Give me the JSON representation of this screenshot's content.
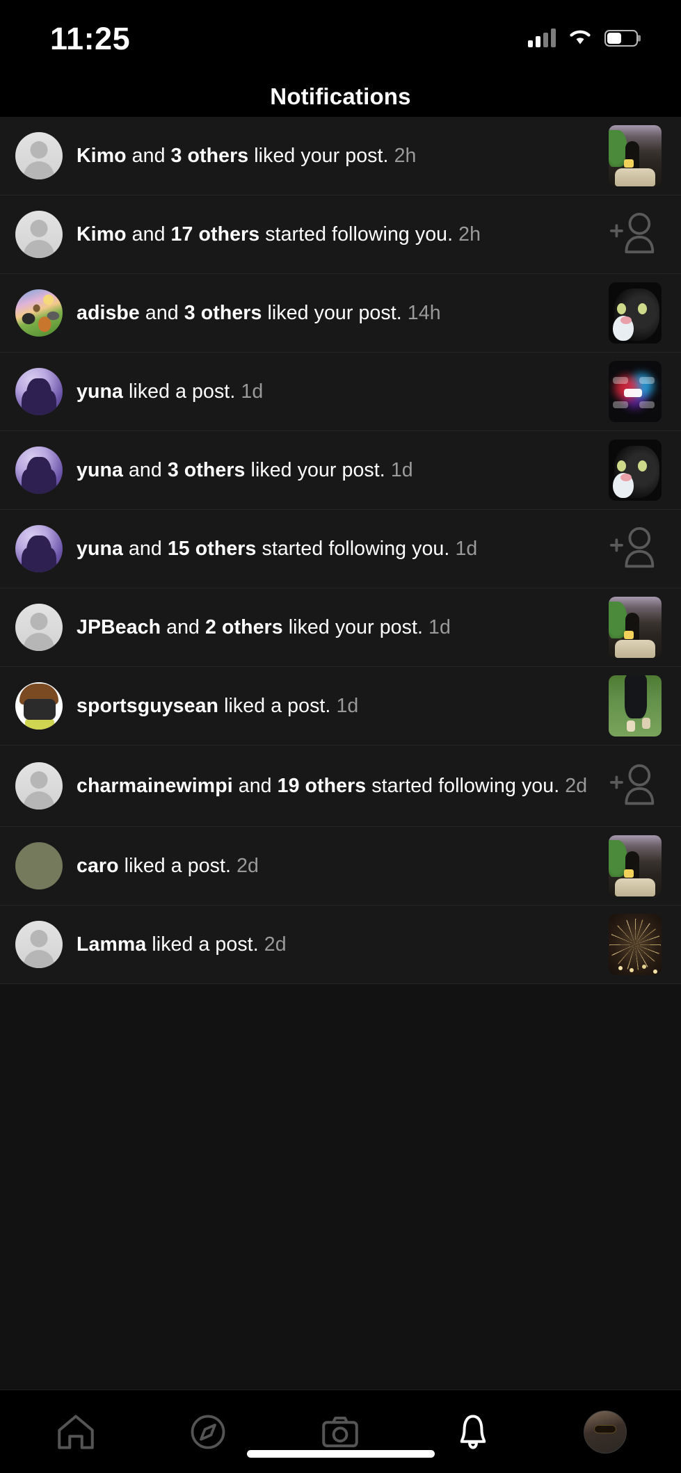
{
  "status_bar": {
    "time": "11:25",
    "signal_bars_filled": 2,
    "signal_bars_total": 4,
    "wifi": "wifi-icon",
    "battery_percent": 50
  },
  "header": {
    "title": "Notifications"
  },
  "notifications": [
    {
      "user": "Kimo",
      "others": "and 3 others",
      "action": "liked your post.",
      "time": "2h",
      "avatar": "default-avatar",
      "right": "post-thumbnail",
      "thumb_kind": "plant-cat-photo"
    },
    {
      "user": "Kimo",
      "others": "and 17 others",
      "action": "started following you.",
      "time": "2h",
      "avatar": "default-avatar",
      "right": "follow-icon",
      "thumb_kind": ""
    },
    {
      "user": "adisbe",
      "others": "and 3 others",
      "action": "liked your post.",
      "time": "14h",
      "avatar": "jungle-avatar",
      "right": "post-thumbnail",
      "thumb_kind": "cat-face-photo"
    },
    {
      "user": "yuna",
      "others": "",
      "action": "liked a post.",
      "time": "1d",
      "avatar": "purple-silhouette-avatar",
      "right": "post-thumbnail",
      "thumb_kind": "glow-likes-photo"
    },
    {
      "user": "yuna",
      "others": "and 3 others",
      "action": "liked your post.",
      "time": "1d",
      "avatar": "purple-silhouette-avatar",
      "right": "post-thumbnail",
      "thumb_kind": "cat-face-photo"
    },
    {
      "user": "yuna",
      "others": "and 15 others",
      "action": "started following you.",
      "time": "1d",
      "avatar": "purple-silhouette-avatar",
      "right": "follow-icon",
      "thumb_kind": ""
    },
    {
      "user": "JPBeach",
      "others": "and 2 others",
      "action": "liked your post.",
      "time": "1d",
      "avatar": "default-avatar",
      "right": "post-thumbnail",
      "thumb_kind": "plant-cat-photo"
    },
    {
      "user": "sportsguysean",
      "others": "",
      "action": "liked a post.",
      "time": "1d",
      "avatar": "photographer-avatar",
      "right": "post-thumbnail",
      "thumb_kind": "grass-dog-photo"
    },
    {
      "user": "charmainewimpi",
      "others": "and 19 others",
      "action": "started following you.",
      "time": "2d",
      "avatar": "default-avatar",
      "right": "follow-icon",
      "thumb_kind": ""
    },
    {
      "user": "caro",
      "others": "",
      "action": "liked a post.",
      "time": "2d",
      "avatar": "olive-avatar",
      "right": "post-thumbnail",
      "thumb_kind": "plant-cat-photo"
    },
    {
      "user": "Lamma",
      "others": "",
      "action": "liked a post.",
      "time": "2d",
      "avatar": "default-avatar",
      "right": "post-thumbnail",
      "thumb_kind": "sparkler-photo"
    }
  ],
  "tab_bar": {
    "items": [
      {
        "name": "home-icon",
        "active": false
      },
      {
        "name": "explore-compass-icon",
        "active": false
      },
      {
        "name": "camera-icon",
        "active": false
      },
      {
        "name": "notifications-bell-icon",
        "active": true
      },
      {
        "name": "profile-avatar",
        "active": false
      }
    ]
  },
  "colors": {
    "background": "#000000",
    "row_background": "#181818",
    "divider": "#262626",
    "text_primary": "#ffffff",
    "text_secondary": "#9a9a9a",
    "icon_inactive": "#555555",
    "icon_active": "#ffffff"
  }
}
